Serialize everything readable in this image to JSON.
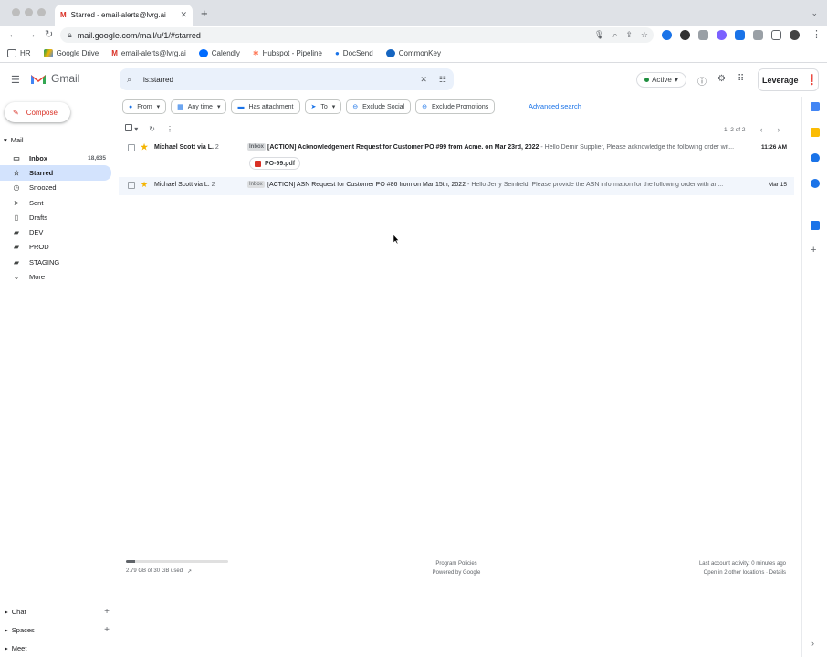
{
  "browser": {
    "tab_title": "Starred - email-alerts@lvrg.ai",
    "url": "mail.google.com/mail/u/1/#starred",
    "bookmarks": [
      "HR",
      "Google Drive",
      "email-alerts@lvrg.ai",
      "Calendly",
      "Hubspot - Pipeline",
      "DocSend",
      "CommonKey"
    ]
  },
  "header": {
    "app_name": "Gmail",
    "search_value": "is:starred",
    "status": "Active",
    "org_button": "Leverage"
  },
  "compose_label": "Compose",
  "sidebar": {
    "section_label": "Mail",
    "items": [
      {
        "label": "Inbox",
        "count": "18,635"
      },
      {
        "label": "Starred",
        "count": ""
      },
      {
        "label": "Snoozed",
        "count": ""
      },
      {
        "label": "Sent",
        "count": ""
      },
      {
        "label": "Drafts",
        "count": ""
      },
      {
        "label": "DEV",
        "count": ""
      },
      {
        "label": "PROD",
        "count": ""
      },
      {
        "label": "STAGING",
        "count": ""
      },
      {
        "label": "More",
        "count": ""
      }
    ],
    "bottom": [
      "Chat",
      "Spaces",
      "Meet"
    ]
  },
  "filters": [
    "From",
    "Any time",
    "Has attachment",
    "To",
    "Exclude Social",
    "Exclude Promotions"
  ],
  "advanced_search": "Advanced search",
  "pagination": "1–2 of 2",
  "emails": [
    {
      "sender": "Michael Scott via L.",
      "count": "2",
      "badge": "Inbox",
      "subject": "[ACTION] Acknowledgement Request for Customer PO #99 from Acme. on Mar 23rd, 2022",
      "snippet": " - Hello Demir Supplier, Please acknowledge the following order wit...",
      "date": "11:26 AM",
      "attachment": "PO-99.pdf"
    },
    {
      "sender": "Michael Scott via L.",
      "count": "2",
      "badge": "Inbox",
      "subject": "[ACTION] ASN Request for Customer PO #86 from on Mar 15th, 2022",
      "snippet": " - Hello Jerry Seinfield, Please provide the ASN information for the following order with an...",
      "date": "Mar 15",
      "attachment": ""
    }
  ],
  "footer": {
    "storage_text": "2.79 GB of 30 GB used",
    "storage_fraction": 0.093,
    "policies": "Program Policies",
    "powered": "Powered by Google",
    "activity": "Last account activity: 0 minutes ago",
    "details": "Open in 2 other locations · Details"
  }
}
